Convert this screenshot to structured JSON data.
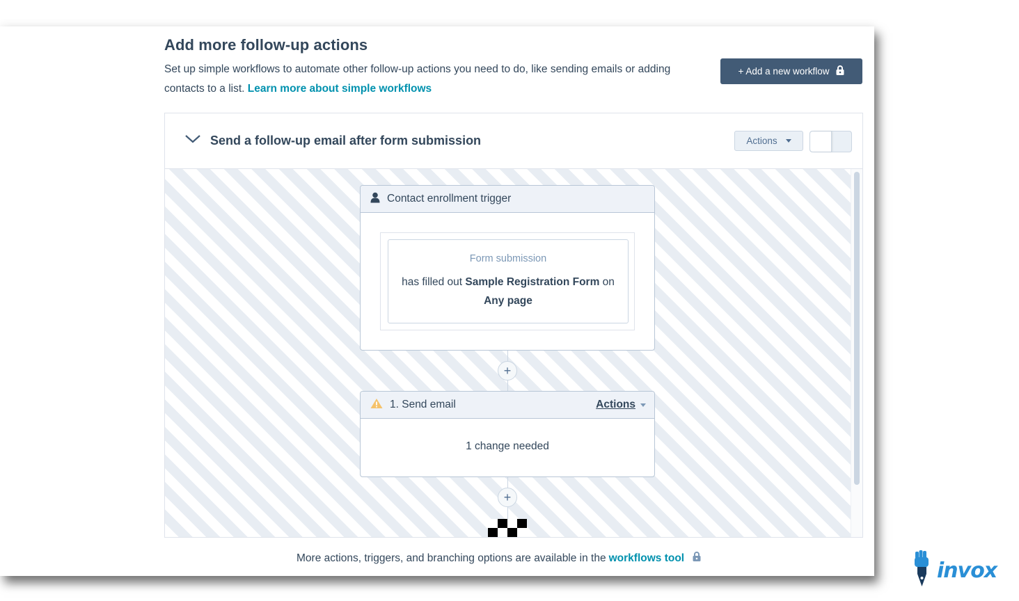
{
  "header": {
    "title": "Add more follow-up actions",
    "description": "Set up simple workflows to automate other follow-up actions you need to do, like sending emails or adding contacts to a list.",
    "learn_more_link": "Learn more about simple workflows",
    "add_workflow_button": "+ Add a new workflow"
  },
  "workflow": {
    "title": "Send a follow-up email after form submission",
    "actions_button": "Actions",
    "enabled": false,
    "trigger": {
      "header": "Contact enrollment trigger",
      "type": "Form submission",
      "text_prefix": "has filled out",
      "form_name": "Sample Registration Form",
      "text_middle": "on",
      "page": "Any page"
    },
    "steps": [
      {
        "label": "1. Send email",
        "actions_label": "Actions",
        "status": "1 change needed",
        "warning": true
      }
    ]
  },
  "footer": {
    "text": "More actions, triggers, and branching options are available in the",
    "link": "workflows tool"
  },
  "brand": {
    "name": "invox"
  },
  "colors": {
    "primary_dark": "#425b76",
    "link": "#0091ae",
    "text": "#33475b",
    "warning": "#f5c26b",
    "brand": "#2a8fd6"
  },
  "icons": {
    "lock": "lock-icon",
    "chevron": "chevron-down-icon",
    "contact": "contact-icon",
    "warning": "warning-icon",
    "plus": "plus-icon",
    "end": "end-flag-icon"
  }
}
